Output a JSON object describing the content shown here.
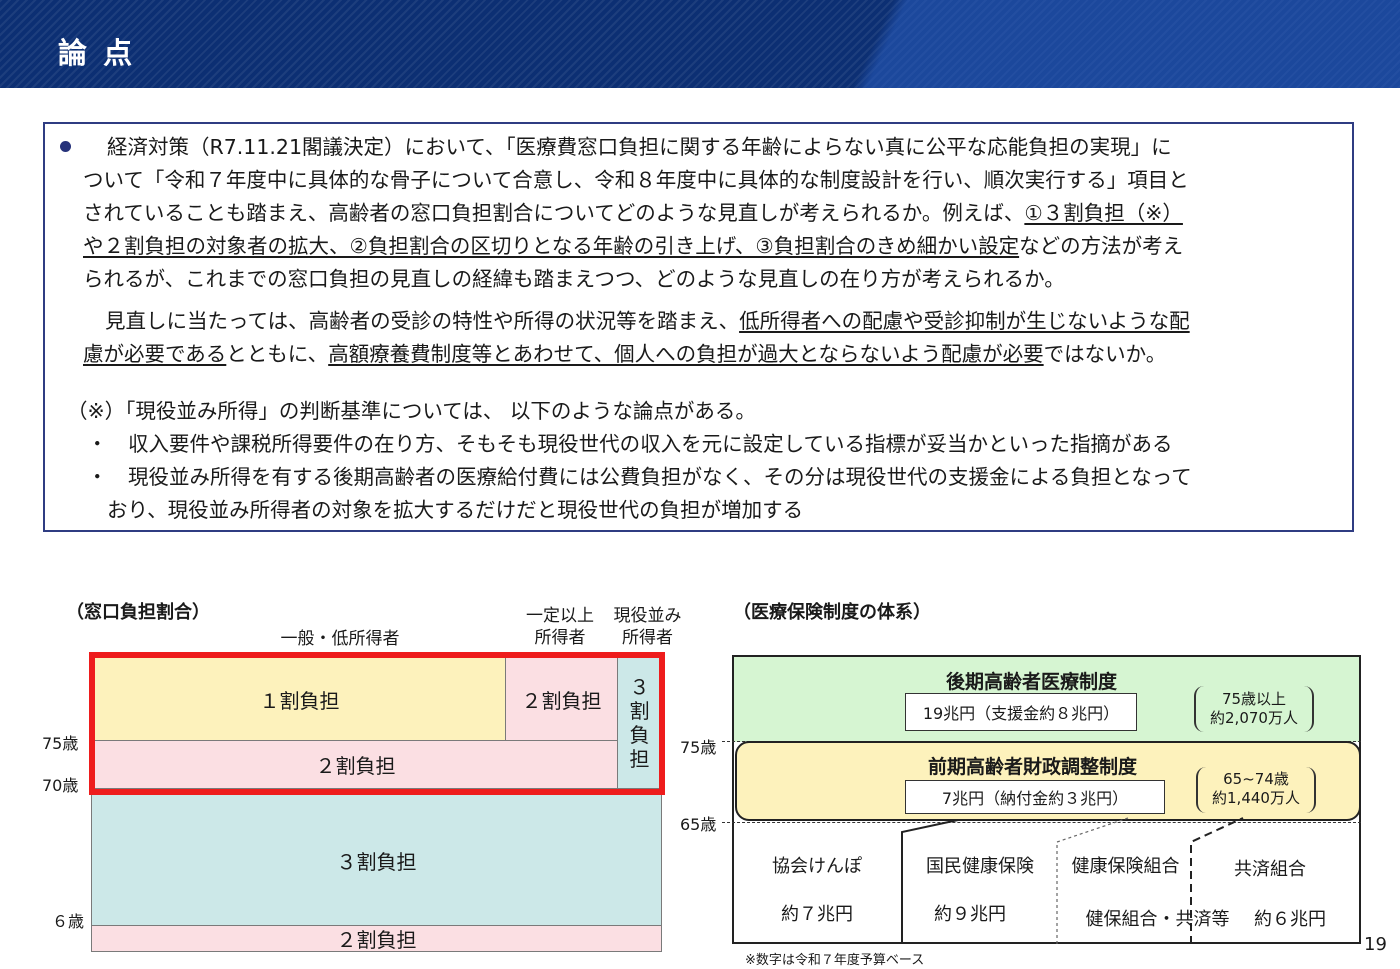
{
  "header": {
    "title": "論 点"
  },
  "body": {
    "para1": [
      "経済対策（R7.11.21閣議決定）において、「医療費窓口負担に関する年齢によらない真に公平な応能負担の実現」に",
      "ついて「令和７年度中に具体的な骨子について合意し、令和８年度中に具体的な制度設計を行い、順次実行する」項目と",
      "されていることも踏まえ、高齢者の窓口負担割合についてどのような見直しが考えられるか。例えば、",
      "①３割負担（※）",
      "や２割負担の対象者の拡大、②負担割合の区切りとなる年齢の引き上げ、③負担割合のきめ細かい設定",
      "などの方法が考え",
      "られるが、これまでの窓口負担の見直しの経緯も踏まえつつ、どのような見直しの在り方が考えられるか。"
    ],
    "para2": [
      "見直しに当たっては、高齢者の受診の特性や所得の状況等を踏まえ、",
      "低所得者への配慮や受診抑制が生じないような配",
      "慮が必要である",
      "とともに、",
      "高額療養費制度等とあわせて、個人への負担が過大とならないよう配慮が必要",
      "ではないか。"
    ],
    "note_head": "（※）「現役並み所得」の判断基準については、 以下のような論点がある。",
    "note_items": [
      "・　収入要件や課税所得要件の在り方、そもそも現役世代の収入を元に設定している指標が妥当かといった指摘がある",
      "・　現役並み所得を有する後期高齢者の医療給付費には公費負担がなく、その分は現役世代の支援金による負担となって",
      "おり、現役並み所得者の対象を拡大するだけだと現役世代の負担が増加する"
    ]
  },
  "left_chart": {
    "title": "（窓口負担割合）",
    "col_general": "一般・低所得者",
    "col_middle": [
      "一定以上",
      "所得者"
    ],
    "col_active": [
      "現役並み",
      "所得者"
    ],
    "cell_1wari": "１割負担",
    "cell_2wari_mid": "２割負担",
    "cell_3wari_vertical": [
      "３",
      "割",
      "負",
      "担"
    ],
    "cell_2wari_70": "２割負担",
    "cell_3wari": "３割負担",
    "cell_2wari_child": "２割負担",
    "age_75": "75歳",
    "age_70": "70歳",
    "age_6": "６歳"
  },
  "right_chart": {
    "title": "（医療保険制度の体系）",
    "kouki_title": "後期高齢者医療制度",
    "kouki_money": "19兆円（支援金約８兆円）",
    "kouki_people": [
      "75歳以上",
      "約2,070万人"
    ],
    "zenki_title": "前期高齢者財政調整制度",
    "zenki_money": "7兆円（納付金約３兆円）",
    "zenki_people": [
      "65~74歳",
      "約1,440万人"
    ],
    "age_75": "75歳",
    "age_65": "65歳",
    "plans": [
      {
        "name": "協会けんぽ",
        "amount": "約７兆円"
      },
      {
        "name": "国民健康保険",
        "amount": "約９兆円"
      },
      {
        "name": "健康保険組合",
        "amount": "健保組合・共済等"
      },
      {
        "name": "共済組合",
        "amount": "約６兆円"
      }
    ],
    "footnote": "※数字は令和７年度予算ベース"
  },
  "page_number": "19"
}
